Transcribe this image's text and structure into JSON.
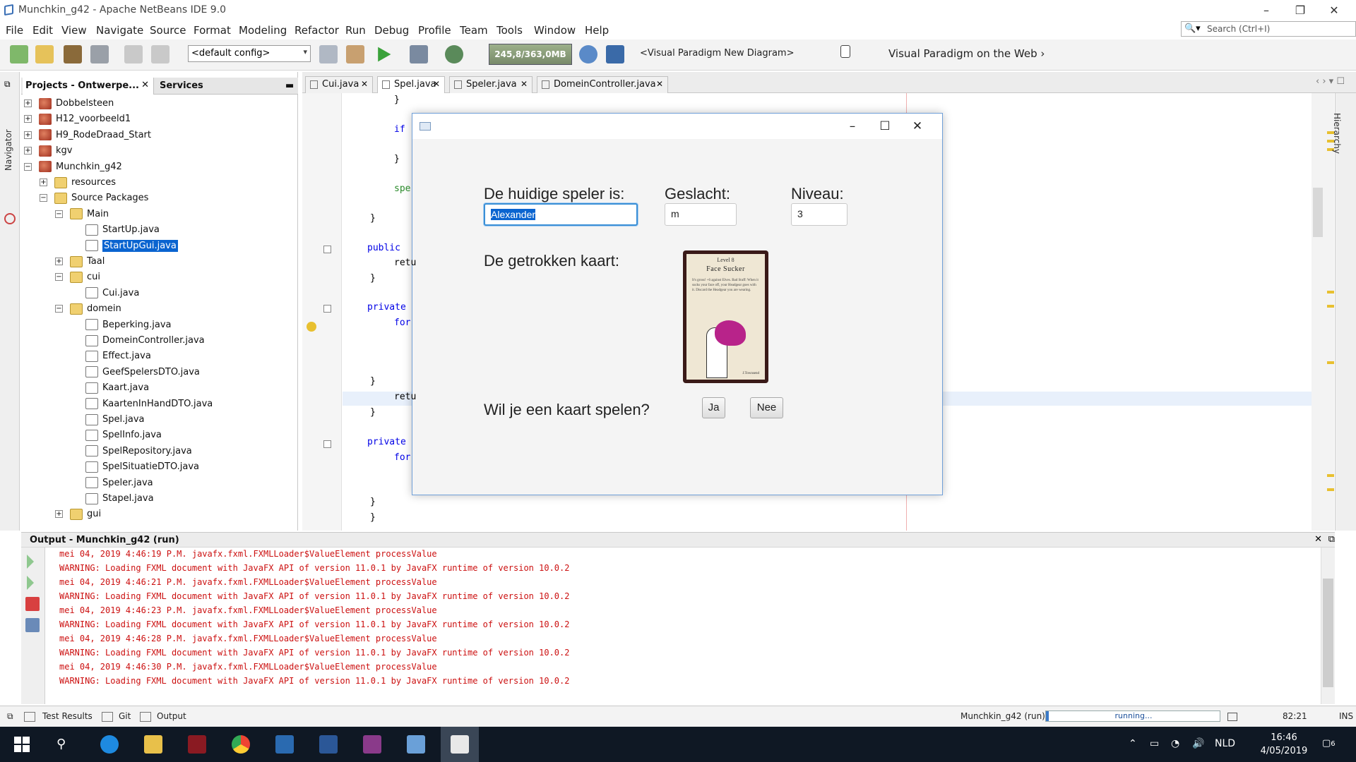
{
  "window": {
    "title": "Munchkin_g42 - Apache NetBeans IDE 9.0"
  },
  "menu": [
    "File",
    "Edit",
    "View",
    "Navigate",
    "Source",
    "Format",
    "Modeling",
    "Refactor",
    "Run",
    "Debug",
    "Profile",
    "Team",
    "Tools",
    "Window",
    "Help"
  ],
  "search": {
    "placeholder": "Search (Ctrl+I)"
  },
  "toolbar": {
    "config": "<default config>",
    "memory": "245,8/363,0MB",
    "vp_diagram": "<Visual Paradigm New Diagram>",
    "vp_web": "Visual Paradigm on the Web",
    "vp_web_arrow": "›"
  },
  "side": {
    "navigator": "Navigator",
    "hierarchy": "Hierarchy"
  },
  "projects": {
    "tab_projects": "Projects - Ontwerpe...",
    "tab_services": "Services",
    "tree": [
      {
        "label": "Dobbelsteen",
        "depth": 0,
        "icon": "project",
        "expander": "+"
      },
      {
        "label": "H12_voorbeeld1",
        "depth": 0,
        "icon": "project",
        "expander": "+"
      },
      {
        "label": "H9_RodeDraad_Start",
        "depth": 0,
        "icon": "project",
        "expander": "+"
      },
      {
        "label": "kgv",
        "depth": 0,
        "icon": "project",
        "expander": "+"
      },
      {
        "label": "Munchkin_g42",
        "depth": 0,
        "icon": "project",
        "expander": "−"
      },
      {
        "label": "resources",
        "depth": 1,
        "icon": "folder",
        "expander": "+"
      },
      {
        "label": "Source Packages",
        "depth": 1,
        "icon": "folder",
        "expander": "−"
      },
      {
        "label": "Main",
        "depth": 2,
        "icon": "package",
        "expander": "−"
      },
      {
        "label": "StartUp.java",
        "depth": 3,
        "icon": "java",
        "expander": ""
      },
      {
        "label": "StartUpGui.java",
        "depth": 3,
        "icon": "java",
        "expander": "",
        "selected": true
      },
      {
        "label": "Taal",
        "depth": 2,
        "icon": "package",
        "expander": "+"
      },
      {
        "label": "cui",
        "depth": 2,
        "icon": "package",
        "expander": "−"
      },
      {
        "label": "Cui.java",
        "depth": 3,
        "icon": "java",
        "expander": ""
      },
      {
        "label": "domein",
        "depth": 2,
        "icon": "package",
        "expander": "−"
      },
      {
        "label": "Beperking.java",
        "depth": 3,
        "icon": "java",
        "expander": ""
      },
      {
        "label": "DomeinController.java",
        "depth": 3,
        "icon": "java",
        "expander": ""
      },
      {
        "label": "Effect.java",
        "depth": 3,
        "icon": "java",
        "expander": ""
      },
      {
        "label": "GeefSpelersDTO.java",
        "depth": 3,
        "icon": "java",
        "expander": ""
      },
      {
        "label": "Kaart.java",
        "depth": 3,
        "icon": "java",
        "expander": ""
      },
      {
        "label": "KaartenInHandDTO.java",
        "depth": 3,
        "icon": "java",
        "expander": ""
      },
      {
        "label": "Spel.java",
        "depth": 3,
        "icon": "java",
        "expander": ""
      },
      {
        "label": "SpelInfo.java",
        "depth": 3,
        "icon": "java",
        "expander": ""
      },
      {
        "label": "SpelRepository.java",
        "depth": 3,
        "icon": "java",
        "expander": ""
      },
      {
        "label": "SpelSituatieDTO.java",
        "depth": 3,
        "icon": "java",
        "expander": ""
      },
      {
        "label": "Speler.java",
        "depth": 3,
        "icon": "java",
        "expander": ""
      },
      {
        "label": "Stapel.java",
        "depth": 3,
        "icon": "java",
        "expander": ""
      },
      {
        "label": "gui",
        "depth": 2,
        "icon": "package",
        "expander": "+"
      }
    ]
  },
  "editor": {
    "tabs": [
      {
        "label": "Cui.java",
        "active": false
      },
      {
        "label": "Spel.java",
        "active": true
      },
      {
        "label": "Speler.java",
        "active": false
      },
      {
        "label": "DomeinController.java",
        "active": false
      }
    ],
    "lines": [
      {
        "text": "}",
        "indent": 3
      },
      {
        "text": "if",
        "indent": 3,
        "kw": true
      },
      {
        "text": "}",
        "indent": 3
      },
      {
        "text": "spe",
        "indent": 3
      },
      {
        "text": "}",
        "indent": 2
      },
      {
        "text": "public",
        "indent": 1,
        "kw": true
      },
      {
        "text": "retu",
        "indent": 2
      },
      {
        "text": "}",
        "indent": 1
      },
      {
        "text": "private",
        "indent": 1,
        "kw": true
      },
      {
        "text": "for",
        "indent": 2,
        "kw": true
      },
      {
        "text": "}",
        "indent": 2
      },
      {
        "text": "retu",
        "indent": 2
      },
      {
        "text": "}",
        "indent": 1
      },
      {
        "text": "private",
        "indent": 1,
        "kw": true
      },
      {
        "text": "for",
        "indent": 2,
        "kw": true
      },
      {
        "text": "}",
        "indent": 2
      },
      {
        "text": "}",
        "indent": 1
      }
    ]
  },
  "dialog": {
    "label_player": "De huidige speler is:",
    "player_value": "Alexander",
    "label_gender": "Geslacht:",
    "gender_value": "m",
    "label_level": "Niveau:",
    "level_value": "3",
    "label_card": "De getrokken kaart:",
    "card": {
      "level": "Level 8",
      "name": "Face Sucker",
      "text1": "It's gross! +6 against Elves.",
      "text2": "Bad Stuff: When it sucks your face off, your Headgear goes with it. Discard the Headgear you are wearing.",
      "signature": "J.Townsend"
    },
    "question": "Wil je een kaart spelen?",
    "btn_yes": "Ja",
    "btn_no": "Nee"
  },
  "output": {
    "title": "Output - Munchkin_g42 (run)",
    "lines": [
      "mei 04, 2019 4:46:19 P.M. javafx.fxml.FXMLLoader$ValueElement processValue",
      "WARNING: Loading FXML document with JavaFX API of version 11.0.1 by JavaFX runtime of version 10.0.2",
      "mei 04, 2019 4:46:21 P.M. javafx.fxml.FXMLLoader$ValueElement processValue",
      "WARNING: Loading FXML document with JavaFX API of version 11.0.1 by JavaFX runtime of version 10.0.2",
      "mei 04, 2019 4:46:23 P.M. javafx.fxml.FXMLLoader$ValueElement processValue",
      "WARNING: Loading FXML document with JavaFX API of version 11.0.1 by JavaFX runtime of version 10.0.2",
      "mei 04, 2019 4:46:28 P.M. javafx.fxml.FXMLLoader$ValueElement processValue",
      "WARNING: Loading FXML document with JavaFX API of version 11.0.1 by JavaFX runtime of version 10.0.2",
      "mei 04, 2019 4:46:30 P.M. javafx.fxml.FXMLLoader$ValueElement processValue",
      "WARNING: Loading FXML document with JavaFX API of version 11.0.1 by JavaFX runtime of version 10.0.2"
    ]
  },
  "status": {
    "test_results": "Test Results",
    "git": "Git",
    "output": "Output",
    "run_label": "Munchkin_g42 (run)",
    "progress_text": "running...",
    "position": "82:21",
    "mode": "INS"
  },
  "taskbar": {
    "lang": "NLD",
    "time": "16:46",
    "date": "4/05/2019",
    "notifications": "6"
  },
  "colors": {
    "output_text": "#cc1010",
    "selection": "#0a64d0",
    "focus": "#3a8fd6"
  }
}
